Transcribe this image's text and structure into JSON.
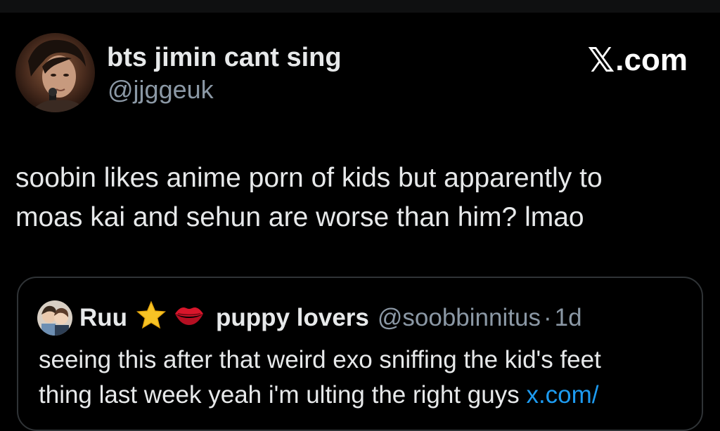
{
  "author": {
    "display_name": "bts jimin cant sing",
    "handle": "@jjggeuk",
    "avatar_icon": "profile-photo"
  },
  "brand": {
    "x_glyph": "𝕏",
    "suffix": ".com"
  },
  "tweet": {
    "line1": "soobin likes anime porn of kids but apparently to",
    "line2": "moas kai and sehun are worse than him? lmao"
  },
  "quoted": {
    "name": "Ruu",
    "name_emoji": [
      "star-emoji",
      "lips-emoji"
    ],
    "name2": "puppy lovers",
    "handle": "@soobbinnitus",
    "separator": "·",
    "time": "1d",
    "line1": "seeing this after that weird exo sniffing the kid's feet",
    "line2_text": "thing last week yeah i'm ulting the right guys ",
    "line2_link": "x.com/"
  },
  "colors": {
    "background": "#000000",
    "text_primary": "#e7e9ea",
    "text_secondary": "#8b98a5",
    "link": "#1d9bf0",
    "border": "#2f3336"
  }
}
